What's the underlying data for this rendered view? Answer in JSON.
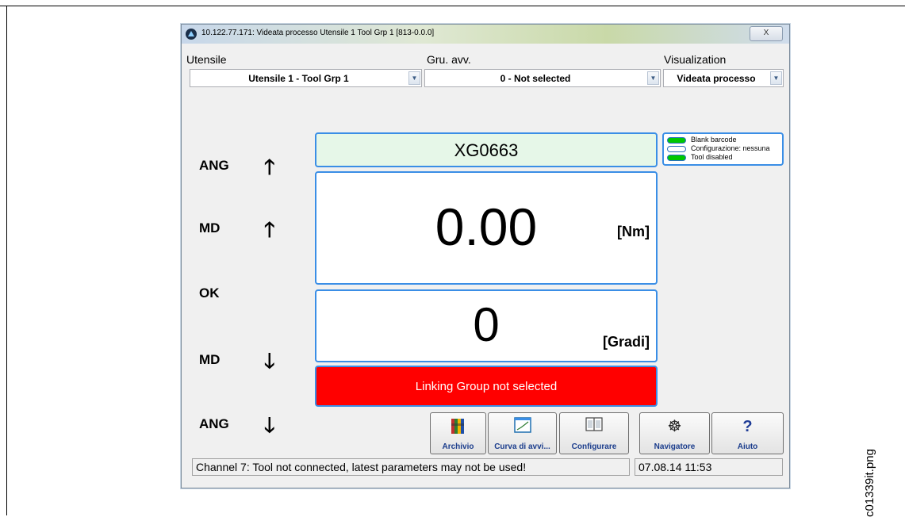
{
  "caption": "c01339it.png",
  "window": {
    "title": "10.122.77.171: Videata processo  Utensile 1  Tool Grp 1 [813-0.0.0]",
    "close_symbol": "X"
  },
  "selectors": {
    "tool": {
      "label": "Utensile",
      "value": "Utensile  1 - Tool Grp 1"
    },
    "group": {
      "label": "Gru. avv.",
      "value": "0 - Not selected"
    },
    "view": {
      "label": "Visualization",
      "value": "Videata processo"
    }
  },
  "limits": [
    {
      "label": "ANG",
      "icon": "arrow-up-icon",
      "glyph": "🡑"
    },
    {
      "label": "MD",
      "icon": "arrow-up-icon",
      "glyph": "🡑"
    },
    {
      "label": "OK",
      "icon": "",
      "glyph": ""
    },
    {
      "label": "MD",
      "icon": "arrow-down-icon",
      "glyph": "🡓"
    },
    {
      "label": "ANG",
      "icon": "arrow-down-icon",
      "glyph": "🡓"
    }
  ],
  "barcode": "XG0663",
  "torque": {
    "value": "0.00",
    "unit": "[Nm]"
  },
  "angle": {
    "value": "0",
    "unit": "[Gradi]"
  },
  "alert": "Linking Group not selected",
  "legend": [
    {
      "label": "Blank barcode",
      "color": "#00c800"
    },
    {
      "label": "Configurazione: nessuna",
      "color": "#ffffff"
    },
    {
      "label": "Tool disabled",
      "color": "#00c800"
    }
  ],
  "toolbar": [
    {
      "label": "Archivio",
      "icon": "binders-icon"
    },
    {
      "label": "Curva di avvi...",
      "icon": "curve-chart-icon"
    },
    {
      "label": "Configurare",
      "icon": "book-icon"
    },
    {
      "label": "Navigatore",
      "icon": "ship-wheel-icon"
    },
    {
      "label": "Aiuto",
      "icon": "help-icon"
    }
  ],
  "status": {
    "message": "Channel 7: Tool not connected, latest parameters may not be used!",
    "datetime": "07.08.14 11:53"
  }
}
